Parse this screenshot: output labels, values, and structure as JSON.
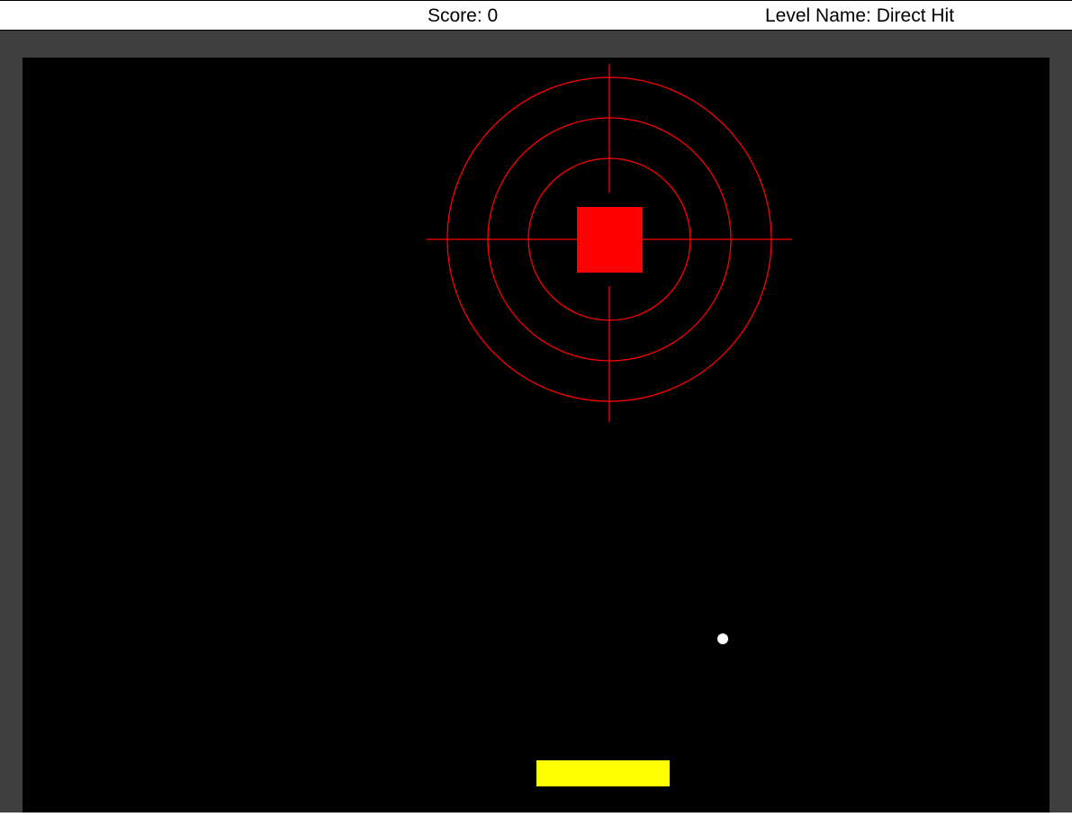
{
  "hud": {
    "score_label": "Score: 0",
    "level_label": "Level Name: Direct Hit"
  },
  "game": {
    "score": 0,
    "level_name": "Direct Hit",
    "colors": {
      "background": "#000000",
      "wall": "#404040",
      "target": "#ff0000",
      "paddle": "#ffff00",
      "ball": "#ffffff"
    }
  }
}
